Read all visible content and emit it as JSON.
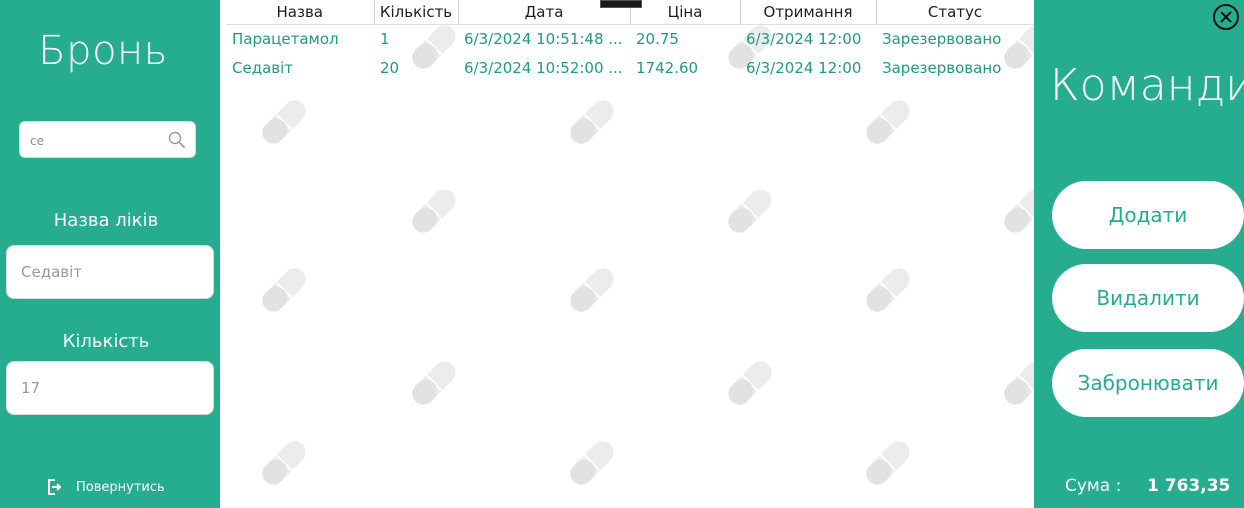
{
  "left_panel": {
    "title": "Бронь",
    "search": {
      "value": "се"
    },
    "name_label": "Назва ліків",
    "name_value": "Седавіт",
    "qty_label": "Кількість",
    "qty_value": "17",
    "back_label": "Повернутись"
  },
  "grid": {
    "columns": [
      "Назва",
      "Кількість",
      "Дата",
      "Ціна",
      "Отримання",
      "Статус"
    ],
    "rows": [
      {
        "name": "Парацетамол",
        "qty": "1",
        "date": "6/3/2024 10:51:48 ...",
        "price": "20.75",
        "received": "6/3/2024 12:00",
        "status": "Зарезервовано"
      },
      {
        "name": "Седавіт",
        "qty": "20",
        "date": "6/3/2024 10:52:00 ...",
        "price": "1742.60",
        "received": "6/3/2024 12:00",
        "status": "Зарезервовано"
      }
    ]
  },
  "right_panel": {
    "title": "Команди",
    "add_label": "Додати",
    "delete_label": "Видалити",
    "book_label": "Забронювати",
    "sum_label": "Сума :",
    "sum_value": "1 763,35"
  },
  "colors": {
    "accent": "#26ad90",
    "row_text": "#1f9c80",
    "watermark": "#ececec"
  },
  "icons": [
    "search-icon",
    "logout-icon",
    "close-icon",
    "pill-icon"
  ]
}
